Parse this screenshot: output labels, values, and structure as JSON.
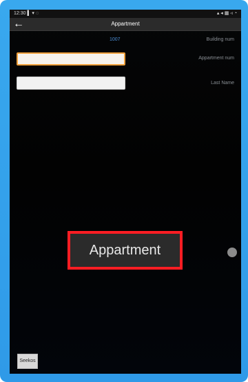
{
  "app": {
    "title": "Appartment"
  },
  "status_bar": {
    "left": "12:30 ▌ ▾ ◌",
    "right": "▴ ◂ ▦ ◃ ◔"
  },
  "form": {
    "building_num_label": "Building num",
    "building_num_value": "1007",
    "appartment_num_label": "Appartment num",
    "last_name_label": "Last Name",
    "appartment_input_value": "",
    "last_name_input_value": ""
  },
  "overlay": {
    "label": "Appartment"
  },
  "footer": {
    "button_label": "Seekos"
  },
  "icons": {
    "back": "arrow-left-icon",
    "dot": "circle-dot-icon"
  },
  "colors": {
    "device_blue": "#39a8ee",
    "screen_bg": "#020202",
    "highlight_red": "#ff1d23",
    "focused_border": "#f0a03a"
  }
}
